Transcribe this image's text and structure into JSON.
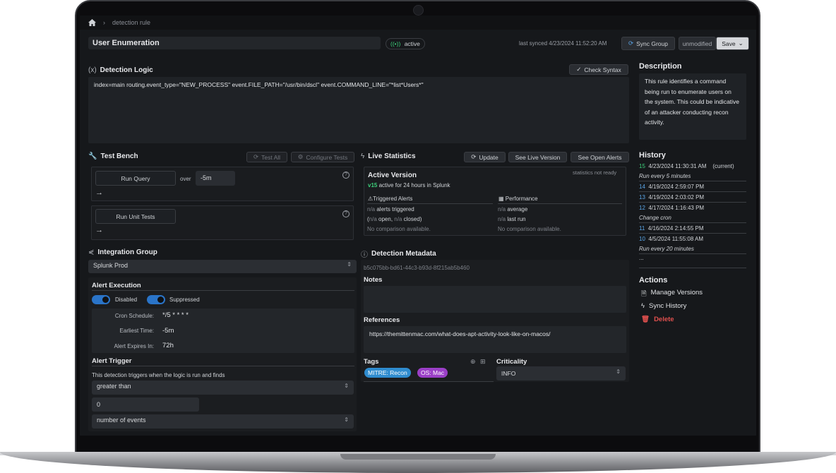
{
  "breadcrumb": {
    "current": "detection rule"
  },
  "header": {
    "rule_name": "User Enumeration",
    "status": "active",
    "last_synced": "last synced 4/23/2024 11:52:20 AM",
    "sync_group_label": "Sync Group",
    "modified_state": "unmodified",
    "save_label": "Save"
  },
  "detection_logic": {
    "title": "Detection Logic",
    "check_syntax_label": "Check Syntax",
    "query": "index=main routing.event_type=\"NEW_PROCESS\" event.FILE_PATH=\"/usr/bin/dscl\" event.COMMAND_LINE=\"*list*Users*\""
  },
  "description": {
    "title": "Description",
    "text": "This rule identifies a command being run to enumerate users on the system. This could be indicative of an attacker conducting recon activity."
  },
  "test_bench": {
    "title": "Test Bench",
    "test_all_label": "Test All",
    "configure_tests_label": "Configure Tests",
    "run_query_label": "Run Query",
    "over_label": "over",
    "timeframe": "-5m",
    "run_unit_tests_label": "Run Unit Tests",
    "arrow": "→"
  },
  "live_statistics": {
    "title": "Live Statistics",
    "update_label": "Update",
    "see_live_version_label": "See Live Version",
    "see_open_alerts_label": "See Open Alerts",
    "active_version_title": "Active Version",
    "stats_status": "statistics not ready",
    "version": "v15",
    "active_for": "active for 24 hours in Splunk",
    "triggered_alerts_title": "Triggered Alerts",
    "performance_title": "Performance",
    "alerts_na": "n/a",
    "alerts_triggered": "alerts triggered",
    "open_na": "n/a",
    "open_label": "open,",
    "closed_na": "n/a",
    "closed_label": "closed)",
    "no_comparison_left": "No comparison available.",
    "avg_na": "n/a",
    "average_label": "average",
    "last_na": "n/a",
    "last_run_label": "last run",
    "no_comparison_right": "No comparison available."
  },
  "history": {
    "title": "History",
    "entries": [
      {
        "version": "15",
        "timestamp": "4/23/2024 11:30:31 AM",
        "suffix": "(current)",
        "note": "Run every 5 minutes"
      },
      {
        "version": "14",
        "timestamp": "4/19/2024 2:59:07 PM"
      },
      {
        "version": "13",
        "timestamp": "4/19/2024 2:03:02 PM"
      },
      {
        "version": "12",
        "timestamp": "4/17/2024 1:16:43 PM",
        "note": "Change cron"
      },
      {
        "version": "11",
        "timestamp": "4/16/2024 2:14:55 PM"
      },
      {
        "version": "10",
        "timestamp": "4/5/2024 11:55:08 AM",
        "note": "Run every 20 minutes"
      }
    ],
    "more": "..."
  },
  "actions": {
    "title": "Actions",
    "manage_versions": "Manage Versions",
    "sync_history": "Sync History",
    "delete": "Delete"
  },
  "integration_group": {
    "title": "Integration Group",
    "selected": "Splunk Prod"
  },
  "alert_execution": {
    "title": "Alert Execution",
    "disabled_label": "Disabled",
    "suppressed_label": "Suppressed",
    "cron_label": "Cron Schedule:",
    "cron_value": "*/5 * * * *",
    "earliest_label": "Earliest Time:",
    "earliest_value": "-5m",
    "expires_label": "Alert Expires In:",
    "expires_value": "72h"
  },
  "alert_trigger": {
    "title": "Alert Trigger",
    "description": "This detection triggers when the logic is run and finds",
    "comparator": "greater than",
    "threshold": "0",
    "unit": "number of events"
  },
  "metadata": {
    "title": "Detection Metadata",
    "id": "b5c075bb-bd61-44c3-b93d-8f215ab5b460",
    "notes_label": "Notes",
    "references_label": "References",
    "reference_url": "https://themittenmac.com/what-does-apt-activity-look-like-on-macos/",
    "tags_label": "Tags",
    "tags": [
      {
        "label": "MITRE: Recon",
        "color": "#2f8ccf"
      },
      {
        "label": "OS: Mac",
        "color": "#9b3fc7"
      }
    ],
    "criticality_label": "Criticality",
    "criticality_value": "INFO"
  }
}
